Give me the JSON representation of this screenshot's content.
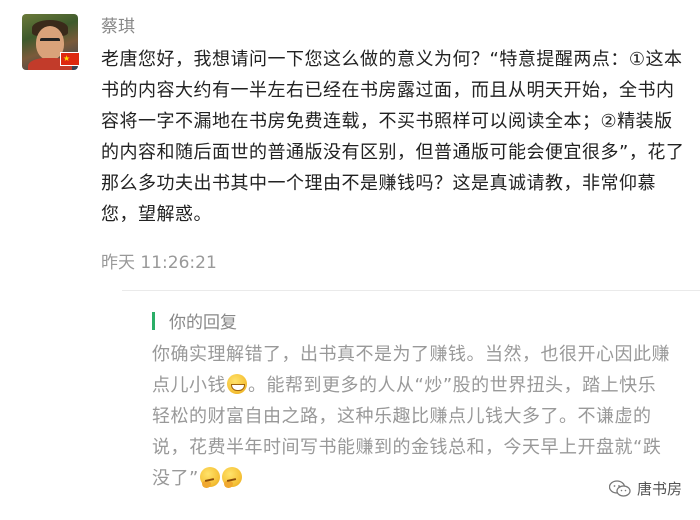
{
  "comment": {
    "username": "蔡琪",
    "message": "老唐您好，我想请问一下您这么做的意义为何？“特意提醒两点：①这本书的内容大约有一半左右已经在书房露过面，而且从明天开始，全书内容将一字不漏地在书房免费连载，不买书照样可以阅读全本；②精装版的内容和随后面世的普通版没有区别，但普通版可能会便宜很多”，花了那么多功夫出书其中一个理由不是赚钱吗？这是真诚请教，非常仰慕您，望解惑。",
    "timestamp": "昨天 11:26:21",
    "avatar_icon": "user-avatar",
    "flag_icon": "china-flag-icon"
  },
  "reply": {
    "label": "你的回复",
    "accent_color": "#2aae67",
    "text_part1": "你确实理解错了，出书真不是为了赚钱。当然，也很开心因此赚点儿小钱",
    "text_part2": "。能帮到更多的人从“炒”股的世界扭头，踏上快乐轻松的财富自由之路，这种乐趣比赚点儿钱大多了。不谦虚的说，花费半年时间写书能赚到的金钱总和，今天早上开盘就“跌没了”",
    "emoji_1": "grinning-emoji",
    "emoji_2": "thinking-emoji"
  },
  "watermark": {
    "text": "唐书房",
    "icon": "wechat-icon"
  }
}
